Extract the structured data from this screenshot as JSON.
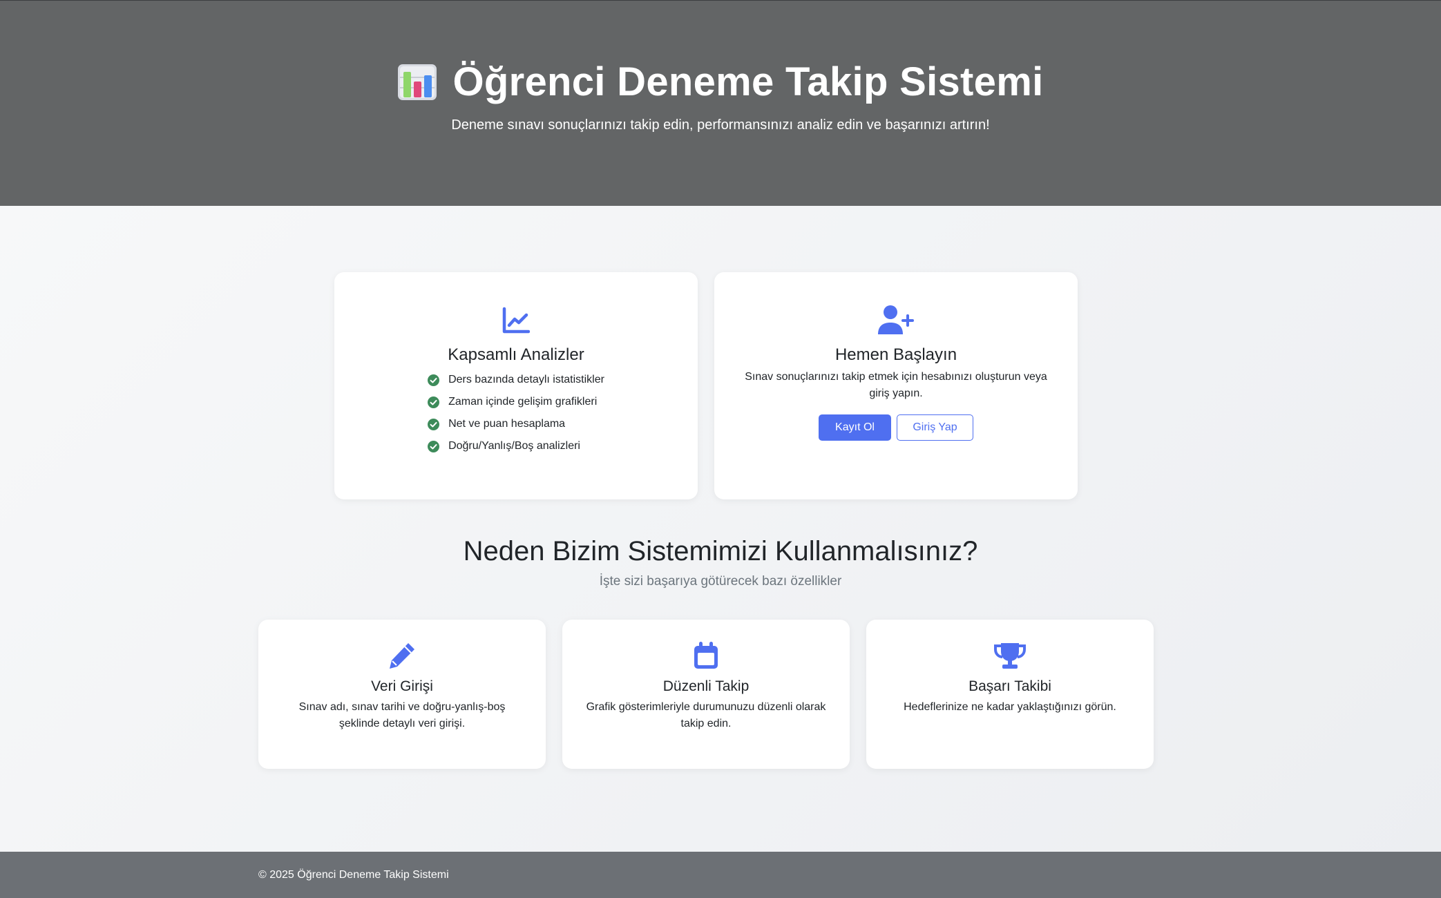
{
  "hero": {
    "title": "Öğrenci Deneme Takip Sistemi",
    "subtitle": "Deneme sınavı sonuçlarınızı takip edin, performansınızı analiz edin ve başarınızı artırın!",
    "icon": "bar-chart-icon"
  },
  "analysis_card": {
    "icon": "line-chart-icon",
    "title": "Kapsamlı Analizler",
    "items": [
      "Ders bazında detaylı istatistikler",
      "Zaman içinde gelişim grafikleri",
      "Net ve puan hesaplama",
      "Doğru/Yanlış/Boş analizleri"
    ],
    "item_icon": "check-circle-icon"
  },
  "start_card": {
    "icon": "user-plus-icon",
    "title": "Hemen Başlayın",
    "text": "Sınav sonuçlarınızı takip etmek için hesabınızı oluşturun veya giriş yapın.",
    "register_label": "Kayıt Ol",
    "login_label": "Giriş Yap"
  },
  "why": {
    "title": "Neden Bizim Sistemimizi Kullanmalısınız?",
    "subtitle": "İşte sizi başarıya götürecek bazı özellikler"
  },
  "features": [
    {
      "icon": "pencil-icon",
      "title": "Veri Girişi",
      "text": "Sınav adı, sınav tarihi ve doğru-yanlış-boş şeklinde detaylı veri girişi."
    },
    {
      "icon": "calendar-icon",
      "title": "Düzenli Takip",
      "text": "Grafik gösterimleriyle durumunuzu düzenli olarak takip edin."
    },
    {
      "icon": "trophy-icon",
      "title": "Başarı Takibi",
      "text": "Hedeflerinize ne kadar yaklaştığınızı görün."
    }
  ],
  "footer": {
    "text": "© 2025 Öğrenci Deneme Takip Sistemi"
  },
  "colors": {
    "hero_bg": "#636566",
    "accent": "#4f6ff0",
    "check": "#3d8b5a",
    "footer_bg": "#6c7075"
  }
}
